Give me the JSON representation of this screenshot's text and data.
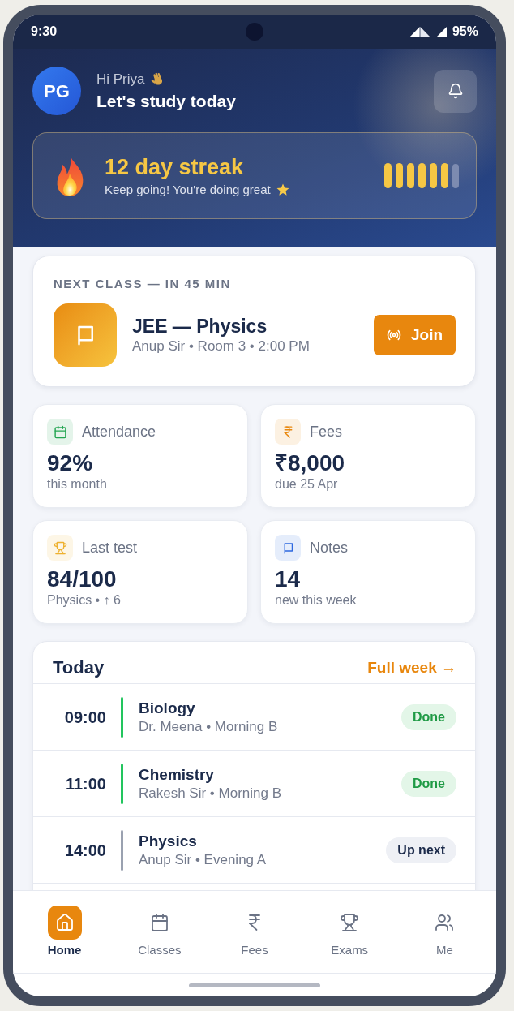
{
  "status_bar": {
    "time": "9:30",
    "battery": "95%"
  },
  "header": {
    "avatar": "PG",
    "greeting": "Hi Priya",
    "title": "Let's study today"
  },
  "streak": {
    "title": "12 day streak",
    "subtitle": "Keep going! You're doing great",
    "days": [
      {
        "done": true
      },
      {
        "done": true
      },
      {
        "done": true
      },
      {
        "done": true
      },
      {
        "done": true
      },
      {
        "done": true
      },
      {
        "done": false
      }
    ]
  },
  "next_class": {
    "label": "NEXT CLASS — IN 45 MIN",
    "title": "JEE — Physics",
    "details": "Anup Sir • Room 3 • 2:00 PM",
    "button": "Join"
  },
  "stats": [
    {
      "label": "Attendance",
      "value": "92%",
      "sub": "this month",
      "color": "#22a550"
    },
    {
      "label": "Fees",
      "value": "₹8,000",
      "sub": "due 25 Apr",
      "color": "#e8880f"
    },
    {
      "label": "Last test",
      "value": "84/100",
      "sub": "Physics • ↑ 6",
      "color": "#eeb12e"
    },
    {
      "label": "Notes",
      "value": "14",
      "sub": "new this week",
      "color": "#2d68e0"
    }
  ],
  "schedule": {
    "title": "Today",
    "link": "Full week →",
    "rows": [
      {
        "time": "09:00",
        "subject": "Biology",
        "details": "Dr. Meena • Morning B",
        "kind": "done",
        "badge": "Done"
      },
      {
        "time": "11:00",
        "subject": "Chemistry",
        "details": "Rakesh Sir • Morning B",
        "kind": "done",
        "badge": "Done"
      },
      {
        "time": "14:00",
        "subject": "Physics",
        "details": "Anup Sir • Evening A",
        "kind": "upcoming",
        "badge": "Up next"
      }
    ]
  },
  "nav": {
    "items": [
      {
        "label": "Home",
        "selected": true
      },
      {
        "label": "Classes",
        "selected": false
      },
      {
        "label": "Fees",
        "selected": false
      },
      {
        "label": "Exams",
        "selected": false
      },
      {
        "label": "Me",
        "selected": false
      }
    ]
  }
}
